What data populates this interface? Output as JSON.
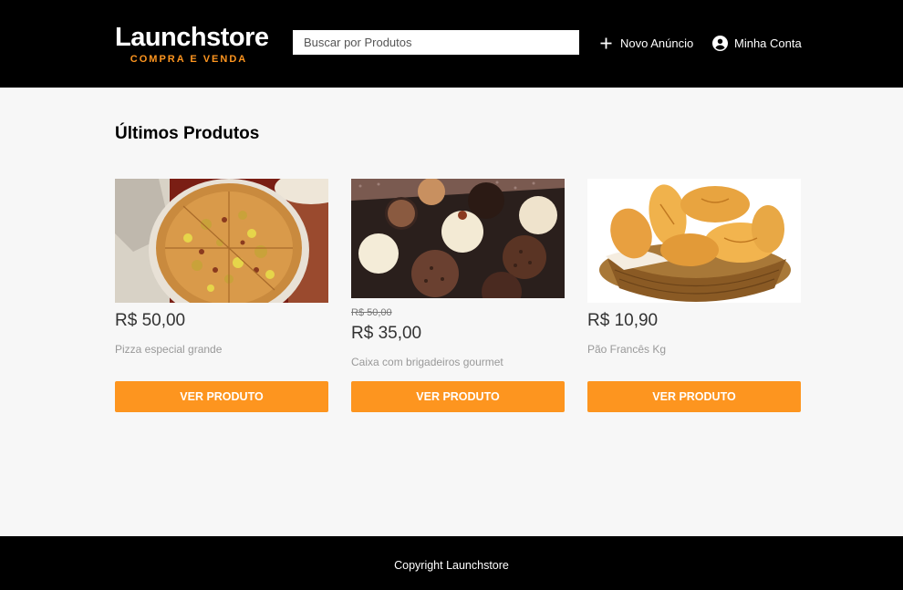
{
  "header": {
    "logo_title": "Launchstore",
    "logo_subtitle": "COMPRA E VENDA",
    "search_placeholder": "Buscar por Produtos",
    "nav": {
      "new_ad": "Novo Anúncio",
      "account": "Minha Conta"
    }
  },
  "main": {
    "section_title": "Últimos Produtos",
    "products": [
      {
        "old_price": "",
        "price": "R$ 50,00",
        "name": "Pizza especial grande",
        "button": "VER PRODUTO"
      },
      {
        "old_price": "R$ 50,00",
        "price": "R$ 35,00",
        "name": "Caixa com brigadeiros gourmet",
        "button": "VER PRODUTO"
      },
      {
        "old_price": "",
        "price": "R$ 10,90",
        "name": "Pão Francês Kg",
        "button": "VER PRODUTO"
      }
    ]
  },
  "footer": {
    "copyright": "Copyright Launchstore"
  },
  "colors": {
    "header_bg": "#000000",
    "accent": "#fd951f",
    "page_bg": "#f7f7f7"
  },
  "icons": [
    "plus-icon",
    "account-circle-icon"
  ]
}
